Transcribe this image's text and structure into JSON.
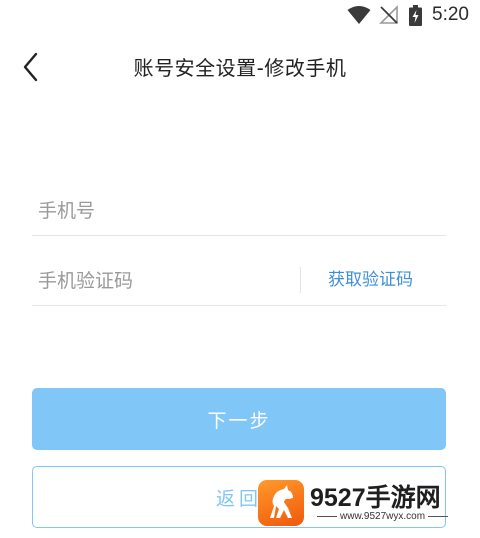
{
  "status_bar": {
    "time": "5:20",
    "icons": [
      "wifi-icon",
      "no-signal-icon",
      "battery-charging-icon"
    ]
  },
  "header": {
    "title": "账号安全设置-修改手机",
    "back_icon": "chevron-left-icon"
  },
  "form": {
    "phone": {
      "value": "",
      "placeholder": "手机号"
    },
    "code": {
      "value": "",
      "placeholder": "手机验证码"
    },
    "get_code_label": "获取验证码"
  },
  "actions": {
    "next_label": "下一步",
    "return_label": "返回"
  },
  "watermark": {
    "title": "9527手游网",
    "url": "www.9527wyx.com"
  },
  "colors": {
    "primary": "#80c7f8",
    "link": "#3d8fd8",
    "watermark_orange": "#f5781a"
  }
}
